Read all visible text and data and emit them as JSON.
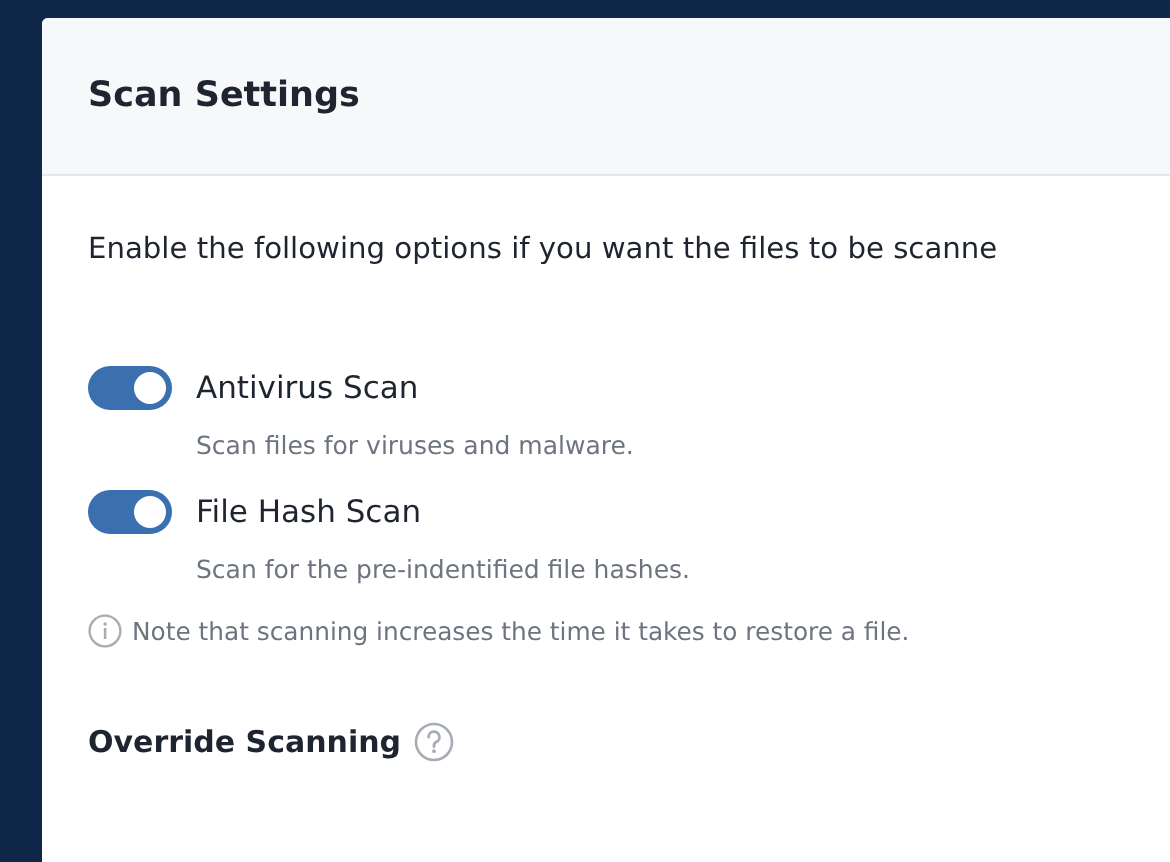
{
  "panel": {
    "title": "Scan Settings"
  },
  "intro": "Enable the following options if you want the files to be scanne",
  "options": [
    {
      "label": "Antivirus Scan",
      "description": "Scan files for viruses and malware.",
      "on": true
    },
    {
      "label": "File Hash Scan",
      "description": "Scan for the pre-indentified file hashes.",
      "on": true
    }
  ],
  "note": "Note that scanning increases the time it takes to restore a file.",
  "override": {
    "title": "Override Scanning"
  }
}
